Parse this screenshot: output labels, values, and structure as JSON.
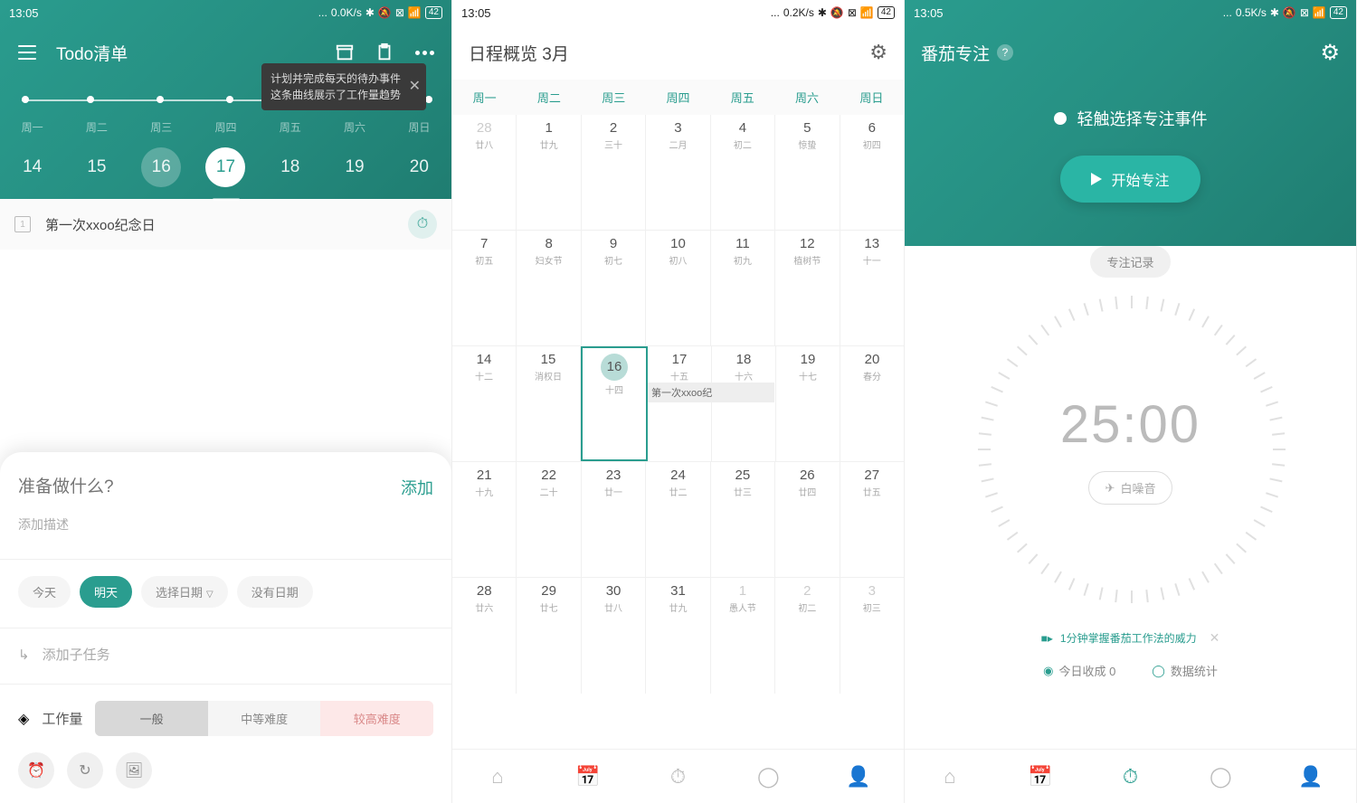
{
  "status": {
    "time": "13:05",
    "speed1": "0.0K/s",
    "speed2": "0.2K/s",
    "speed3": "0.5K/s",
    "batt": "42"
  },
  "s1": {
    "title": "Todo清单",
    "tooltip_l1": "计划并完成每天的待办事件",
    "tooltip_l2": "这条曲线展示了工作量趋势",
    "weekdays": [
      "周一",
      "周二",
      "周三",
      "周四",
      "周五",
      "周六",
      "周日"
    ],
    "dates": [
      "14",
      "15",
      "16",
      "17",
      "18",
      "19",
      "20"
    ],
    "todo1": "第一次xxoo纪念日",
    "placeholder": "准备做什么?",
    "add": "添加",
    "desc": "添加描述",
    "chips": {
      "today": "今天",
      "tomorrow": "明天",
      "pick": "选择日期",
      "none": "没有日期"
    },
    "subtask": "添加子任务",
    "workload": "工作量",
    "diff": {
      "normal": "一般",
      "medium": "中等难度",
      "hard": "较高难度"
    }
  },
  "s2": {
    "title": "日程概览  3月",
    "weekdays": [
      "周一",
      "周二",
      "周三",
      "周四",
      "周五",
      "周六",
      "周日"
    ],
    "event": "第一次xxoo纪",
    "rows": [
      [
        {
          "d": "28",
          "s": "廿八",
          "dim": true
        },
        {
          "d": "1",
          "s": "廿九"
        },
        {
          "d": "2",
          "s": "三十"
        },
        {
          "d": "3",
          "s": "二月"
        },
        {
          "d": "4",
          "s": "初二"
        },
        {
          "d": "5",
          "s": "惊蛰"
        },
        {
          "d": "6",
          "s": "初四"
        }
      ],
      [
        {
          "d": "7",
          "s": "初五"
        },
        {
          "d": "8",
          "s": "妇女节"
        },
        {
          "d": "9",
          "s": "初七"
        },
        {
          "d": "10",
          "s": "初八"
        },
        {
          "d": "11",
          "s": "初九"
        },
        {
          "d": "12",
          "s": "植树节"
        },
        {
          "d": "13",
          "s": "十一"
        }
      ],
      [
        {
          "d": "14",
          "s": "十二"
        },
        {
          "d": "15",
          "s": "消权日"
        },
        {
          "d": "16",
          "s": "十四",
          "today": true
        },
        {
          "d": "17",
          "s": "十五",
          "event": true
        },
        {
          "d": "18",
          "s": "十六"
        },
        {
          "d": "19",
          "s": "十七"
        },
        {
          "d": "20",
          "s": "春分"
        }
      ],
      [
        {
          "d": "21",
          "s": "十九"
        },
        {
          "d": "22",
          "s": "二十"
        },
        {
          "d": "23",
          "s": "廿一"
        },
        {
          "d": "24",
          "s": "廿二"
        },
        {
          "d": "25",
          "s": "廿三"
        },
        {
          "d": "26",
          "s": "廿四"
        },
        {
          "d": "27",
          "s": "廿五"
        }
      ],
      [
        {
          "d": "28",
          "s": "廿六"
        },
        {
          "d": "29",
          "s": "廿七"
        },
        {
          "d": "30",
          "s": "廿八"
        },
        {
          "d": "31",
          "s": "廿九"
        },
        {
          "d": "1",
          "s": "愚人节",
          "dim": true
        },
        {
          "d": "2",
          "s": "初二",
          "dim": true
        },
        {
          "d": "3",
          "s": "初三",
          "dim": true
        }
      ]
    ]
  },
  "s3": {
    "title": "番茄专注",
    "select": "轻触选择专注事件",
    "start": "开始专注",
    "record": "专注记录",
    "timer": "25:00",
    "noise": "白噪音",
    "tip": "1分钟掌握番茄工作法的威力",
    "harvest": "今日收成 0",
    "stats": "数据统计"
  }
}
